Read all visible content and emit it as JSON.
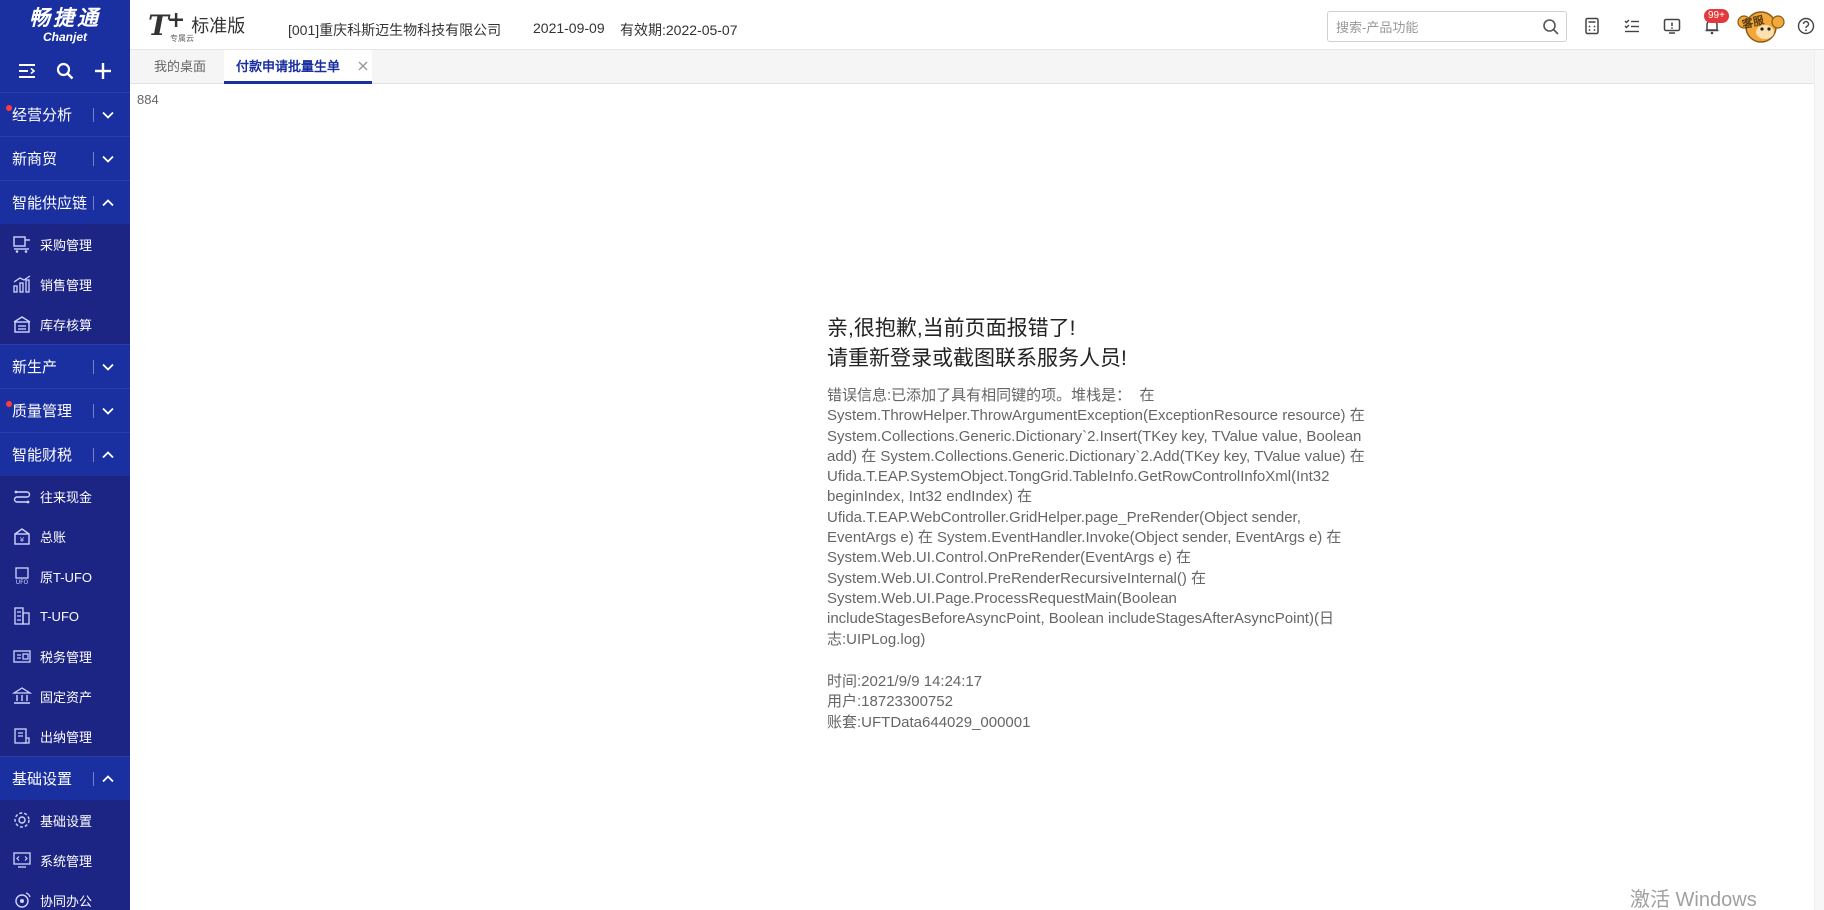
{
  "header": {
    "logo_cn": "畅捷通",
    "logo_en": "Chanjet",
    "product_mark": "T",
    "product_plus": "+",
    "product_sub": "专属云",
    "product_name": "标准版",
    "company": "[001]重庆科斯迈生物科技有限公司",
    "date": "2021-09-09",
    "valid_until": "有效期:2022-05-07",
    "search_placeholder": "搜索-产品功能",
    "notification_count": "99+",
    "service_label": "客服"
  },
  "sidebar": {
    "groups": [
      {
        "label": "经营分析",
        "expanded": false,
        "has_dot": true
      },
      {
        "label": "新商贸",
        "expanded": false,
        "has_dot": false
      },
      {
        "label": "智能供应链",
        "expanded": true,
        "has_dot": false,
        "items": [
          "采购管理",
          "销售管理",
          "库存核算"
        ]
      },
      {
        "label": "新生产",
        "expanded": false,
        "has_dot": false
      },
      {
        "label": "质量管理",
        "expanded": false,
        "has_dot": true
      },
      {
        "label": "智能财税",
        "expanded": true,
        "has_dot": false,
        "items": [
          "往来现金",
          "总账",
          "原T-UFO",
          "T-UFO",
          "税务管理",
          "固定资产",
          "出纳管理"
        ]
      },
      {
        "label": "基础设置",
        "expanded": true,
        "has_dot": false,
        "items": [
          "基础设置",
          "系统管理",
          "协同办公"
        ]
      }
    ]
  },
  "tabs": [
    {
      "label": "我的桌面",
      "active": false
    },
    {
      "label": "付款申请批量生单",
      "active": true
    }
  ],
  "content": {
    "counter": "884",
    "title_line1": "亲,很抱歉,当前页面报错了!",
    "title_line2": "请重新登录或截图联系服务人员!",
    "error_detail": "错误信息:已添加了具有相同键的项。堆栈是：  在 System.ThrowHelper.ThrowArgumentException(ExceptionResource resource) 在 System.Collections.Generic.Dictionary`2.Insert(TKey key, TValue value, Boolean add) 在 System.Collections.Generic.Dictionary`2.Add(TKey key, TValue value) 在 Ufida.T.EAP.SystemObject.TongGrid.TableInfo.GetRowControlInfoXml(Int32 beginIndex, Int32 endIndex) 在 Ufida.T.EAP.WebController.GridHelper.page_PreRender(Object sender, EventArgs e) 在 System.EventHandler.Invoke(Object sender, EventArgs e) 在 System.Web.UI.Control.OnPreRender(EventArgs e) 在 System.Web.UI.Control.PreRenderRecursiveInternal() 在 System.Web.UI.Page.ProcessRequestMain(Boolean includeStagesBeforeAsyncPoint, Boolean includeStagesAfterAsyncPoint)(日志:UIPLog.log)",
    "time": "时间:2021/9/9 14:24:17",
    "user": "用户:18723300752",
    "account": "账套:UFTData644029_000001"
  },
  "watermark": "激活 Windows",
  "colors": {
    "brand_blue": "#1a2fa0",
    "sidebar_bg": "#1c2484",
    "badge_red": "#e4393c"
  }
}
